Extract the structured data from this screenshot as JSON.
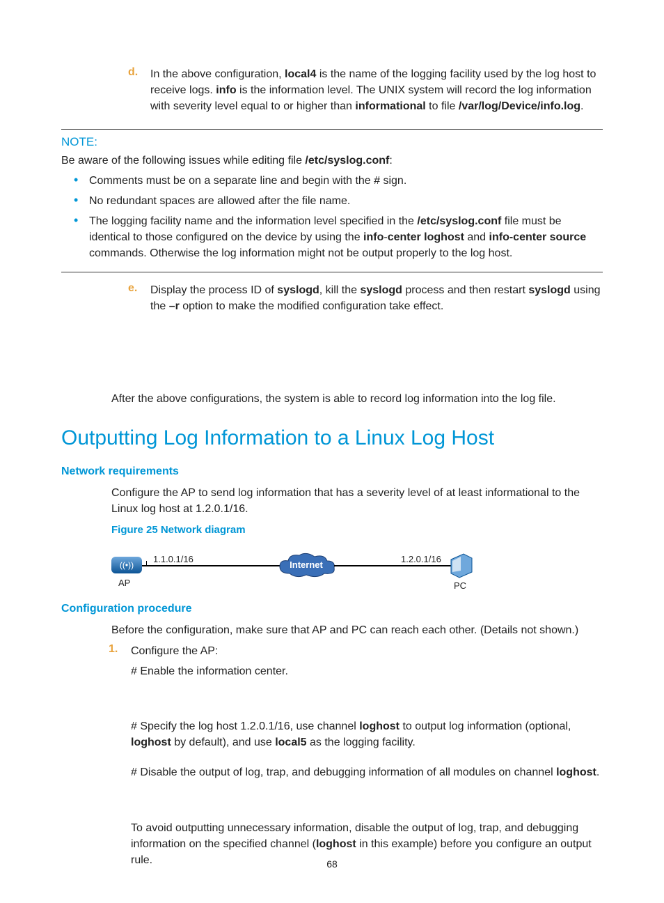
{
  "item_d": {
    "marker": "d.",
    "pre1": "In the above configuration, ",
    "b1": "local4",
    "mid1": " is the name of the logging facility used by the log host to receive logs. ",
    "b2": "info",
    "mid2": " is the information level. The UNIX system will record the log information with severity level equal to or higher than ",
    "b3": "informational",
    "mid3": " to file ",
    "b4": "/var/log/Device/info.log",
    "tail": "."
  },
  "note": {
    "title": "NOTE:",
    "intro_pre": "Be aware of the following issues while editing file ",
    "intro_b": "/etc/syslog.conf",
    "intro_post": ":",
    "bul1": "Comments must be on a separate line and begin with the # sign.",
    "bul2": "No redundant spaces are allowed after the file name.",
    "bul3_pre": "The logging facility name and the information level specified in the ",
    "bul3_b1": "/etc/syslog.conf",
    "bul3_mid1": " file must be identical to those configured on the device by using the ",
    "bul3_b2": "info",
    "bul3_dash": "-",
    "bul3_b3": "center loghost",
    "bul3_mid2": " and ",
    "bul3_b4": "info-center source",
    "bul3_tail": " commands. Otherwise the log information might not be output properly to the log host."
  },
  "item_e": {
    "marker": "e.",
    "pre": "Display the process ID of ",
    "b1": "syslogd",
    "mid1": ", kill the ",
    "b2": "syslogd",
    "mid2": " process and then restart ",
    "b3": "syslogd",
    "mid3": " using the ",
    "b4": "–r",
    "tail": " option to make the modified configuration take effect."
  },
  "after": "After the above configurations, the system is able to record log information into the log file.",
  "h1": "Outputting Log Information to a Linux Log Host",
  "netreq": {
    "heading": "Network requirements",
    "para": "Configure the AP to send log information that has a severity level of at least informational to the Linux log host at 1.2.0.1/16."
  },
  "figcap": "Figure 25 Network diagram",
  "diagram": {
    "ap_glyph": "((•))",
    "ap_label": "AP",
    "ap_ip": "1.1.0.1/16",
    "cloud": "Internet",
    "pc_ip": "1.2.0.1/16",
    "pc_label": "PC"
  },
  "confproc": {
    "heading": "Configuration procedure",
    "intro": "Before the configuration, make sure that AP and PC can reach each other. (Details not shown.)",
    "step1_marker": "1.",
    "step1_label": "Configure the AP:",
    "s1a": "# Enable the information center.",
    "s1b_pre": "# Specify the log host 1.2.0.1/16, use channel ",
    "s1b_b1": "loghost",
    "s1b_mid1": " to output log information (optional, ",
    "s1b_b2": "loghost",
    "s1b_mid2": " by default), and use ",
    "s1b_b3": "local5",
    "s1b_tail": " as the logging facility.",
    "s1c_pre": "# Disable the output of log, trap, and debugging information of all modules on channel ",
    "s1c_b": "loghost",
    "s1c_tail": ".",
    "s1d_pre": "To avoid outputting unnecessary information, disable the output of log, trap, and debugging information on the specified channel (",
    "s1d_b": "loghost",
    "s1d_tail": " in this example) before you configure an output rule."
  },
  "pagenum": "68"
}
